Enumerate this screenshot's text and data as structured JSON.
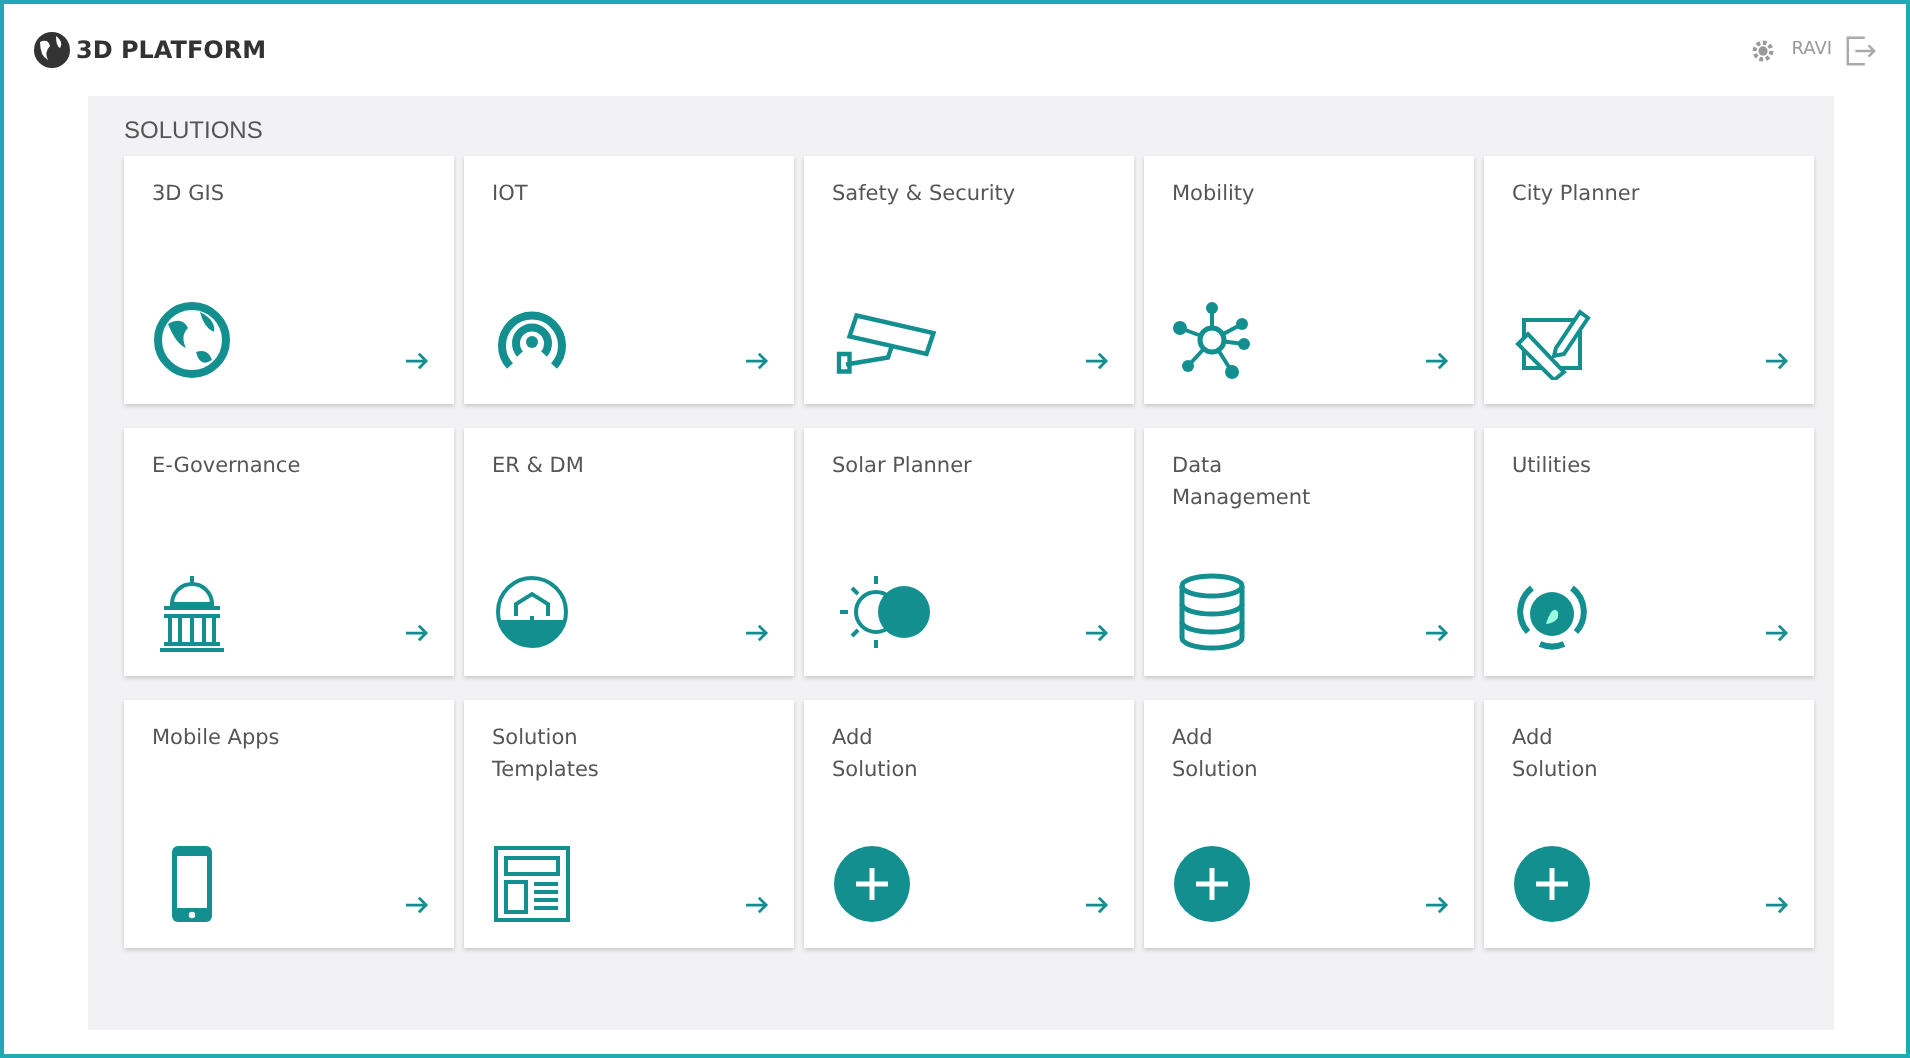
{
  "header": {
    "title": "3D PLATFORM",
    "user": "RAVI"
  },
  "section": {
    "title": "SOLUTIONS"
  },
  "tiles": [
    {
      "label": "3D GIS",
      "kind": "globe"
    },
    {
      "label": "IOT",
      "kind": "signal"
    },
    {
      "label": "Safety & Security",
      "kind": "camera"
    },
    {
      "label": "Mobility",
      "kind": "network"
    },
    {
      "label": "City Planner",
      "kind": "planner"
    },
    {
      "label": "E-Governance",
      "kind": "capitol"
    },
    {
      "label": "ER & DM",
      "kind": "disaster"
    },
    {
      "label": "Solar Planner",
      "kind": "solar"
    },
    {
      "label": "Data\nManagement",
      "kind": "database"
    },
    {
      "label": "Utilities",
      "kind": "utilities"
    },
    {
      "label": "Mobile Apps",
      "kind": "phone"
    },
    {
      "label": "Solution\nTemplates",
      "kind": "template"
    },
    {
      "label": "Add\nSolution",
      "kind": "add"
    },
    {
      "label": "Add\nSolution",
      "kind": "add"
    },
    {
      "label": "Add\nSolution",
      "kind": "add"
    }
  ]
}
